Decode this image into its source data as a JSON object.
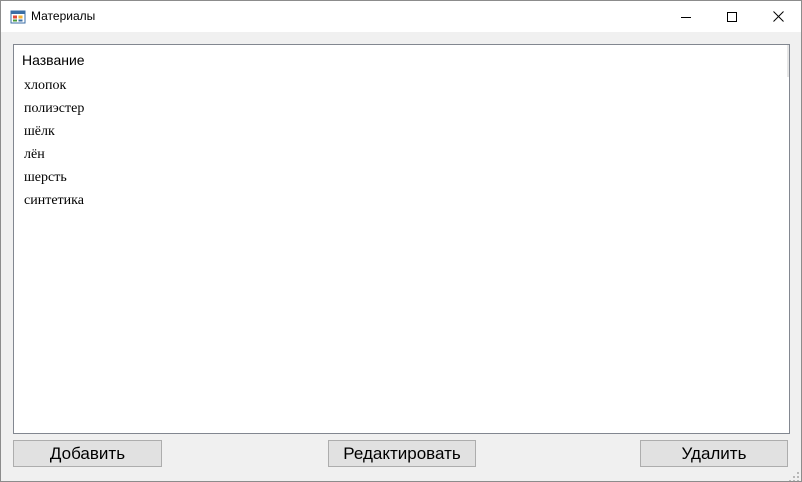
{
  "window": {
    "title": "Материалы",
    "icon": "form-icon",
    "controls": [
      "minimize-icon",
      "maximize-icon",
      "close-icon"
    ]
  },
  "list": {
    "column_header": "Название",
    "items": [
      "хлопок",
      "полиэстер",
      "шёлк",
      "лён",
      "шерсть",
      "синтетика"
    ]
  },
  "buttons": {
    "add": "Добавить",
    "edit": "Редактировать",
    "delete": "Удалить"
  },
  "colors": {
    "window_bg": "#f0f0f0",
    "titlebar_bg": "#ffffff",
    "button_bg": "#e1e1e1",
    "border": "#adadad"
  }
}
